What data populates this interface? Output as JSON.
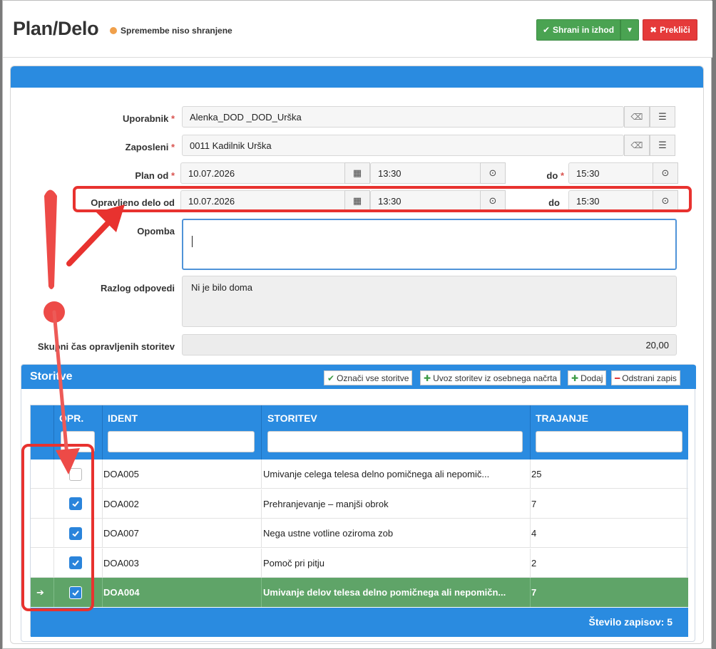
{
  "header": {
    "title": "Plan/Delo",
    "unsaved_text": "Spremembe niso shranjene",
    "save_label": "Shrani in izhod",
    "cancel_label": "Prekliči"
  },
  "form": {
    "uporabnik_label": "Uporabnik",
    "uporabnik_value": "Alenka_DOD _DOD_Urška",
    "zaposleni_label": "Zaposleni",
    "zaposleni_value": "0011 Kadilnik Urška",
    "plan_od_label": "Plan od",
    "plan_od_date": "10.07.2026",
    "plan_od_time": "13:30",
    "plan_do_label": "do",
    "plan_do_time": "15:30",
    "opravljeno_label": "Opravljeno delo od",
    "opravljeno_date": "10.07.2026",
    "opravljeno_time": "13:30",
    "opravljeno_do_label": "do",
    "opravljeno_do_time": "15:30",
    "opomba_label": "Opomba",
    "opomba_value": "",
    "razlog_label": "Razlog odpovedi",
    "razlog_value": "Ni je bilo doma",
    "skupni_label": "Skupni čas opravljenih storitev",
    "skupni_value": "20,00"
  },
  "services": {
    "title": "Storitve",
    "btn_mark_all": "Označi vse storitve",
    "btn_import": "Uvoz storitev iz osebnega načrta",
    "btn_add": "Dodaj",
    "btn_remove": "Odstrani zapis",
    "columns": {
      "opr": "OPR.",
      "ident": "IDENT",
      "storitev": "STORITEV",
      "trajanje": "TRAJANJE"
    },
    "rows": [
      {
        "checked": false,
        "ident": "DOA005",
        "storitev": "Umivanje celega telesa delno pomičnega ali nepomič...",
        "trajanje": "25"
      },
      {
        "checked": true,
        "ident": "DOA002",
        "storitev": "Prehranjevanje – manjši obrok",
        "trajanje": "7"
      },
      {
        "checked": true,
        "ident": "DOA007",
        "storitev": "Nega ustne votline oziroma zob",
        "trajanje": "4"
      },
      {
        "checked": true,
        "ident": "DOA003",
        "storitev": "Pomoč pri pitju",
        "trajanje": "2"
      },
      {
        "checked": true,
        "ident": "DOA004",
        "storitev": "Umivanje delov telesa delno pomičnega ali nepomičn...",
        "trajanje": "7",
        "selected": true
      }
    ],
    "footer_label": "Število zapisov:",
    "footer_count": "5"
  },
  "colors": {
    "primary_blue": "#2a8be0",
    "save_green": "#4aa352",
    "cancel_red": "#e53a3a",
    "selected_row_green": "#5fa468",
    "annotation_red": "#e8322f",
    "unsaved_dot": "#f0a04b"
  },
  "icons": [
    "check-icon",
    "chevron-down-icon",
    "times-icon",
    "eraser-icon",
    "list-icon",
    "calendar-icon",
    "clock-icon",
    "plus-icon",
    "minus-icon",
    "arrow-right-icon"
  ]
}
